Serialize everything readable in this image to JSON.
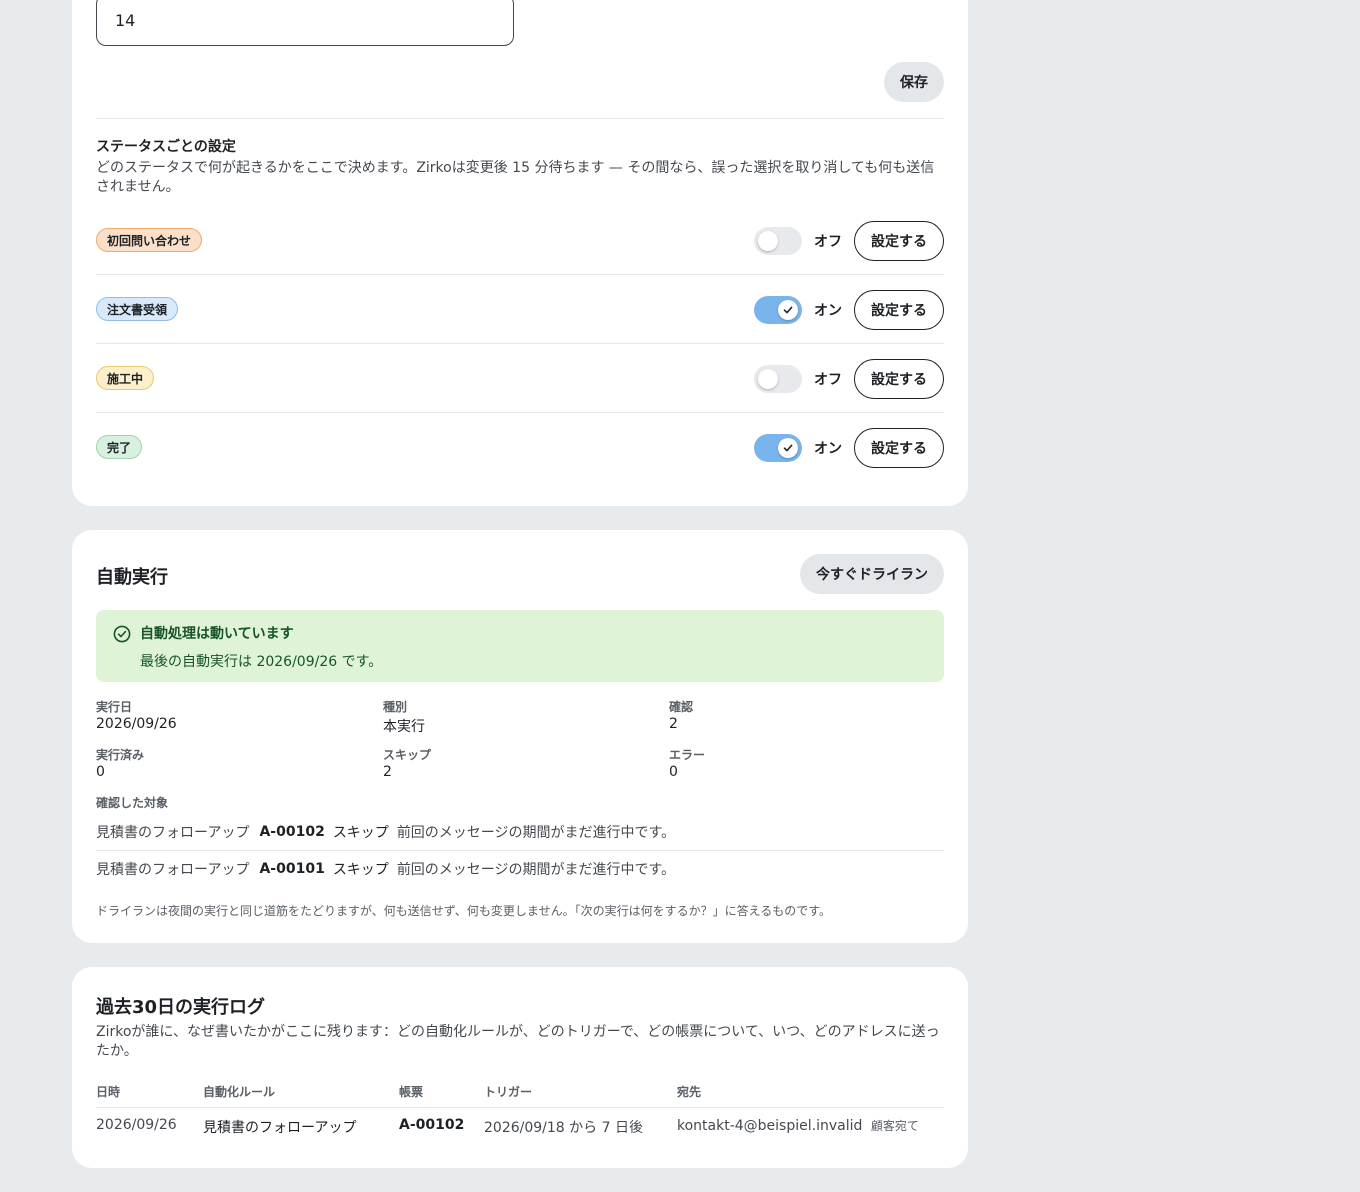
{
  "rules_card": {
    "input_value": "14",
    "save_label": "保存",
    "status_section_title": "ステータスごとの設定",
    "status_section_desc": "どのステータスで何が起きるかをここで決めます。Zirkoは変更後 15 分待ちます — その間なら、誤った選択を取り消しても何も送信されません。",
    "statuses": [
      {
        "label": "初回問い合わせ",
        "state": "オフ",
        "enabled": false,
        "button": "設定する",
        "bg": "#fbe0c9",
        "border": "#f0a969"
      },
      {
        "label": "注文書受領",
        "state": "オン",
        "enabled": true,
        "button": "設定する",
        "bg": "#d7e9fb",
        "border": "#8fbdea"
      },
      {
        "label": "施工中",
        "state": "オフ",
        "enabled": false,
        "button": "設定する",
        "bg": "#fbefcc",
        "border": "#e9c96c"
      },
      {
        "label": "完了",
        "state": "オン",
        "enabled": true,
        "button": "設定する",
        "bg": "#d8f0df",
        "border": "#9fd4ae"
      }
    ]
  },
  "auto_run": {
    "title": "自動実行",
    "dry_run_button": "今すぐドライラン",
    "alert_title": "自動処理は動いています",
    "alert_message": "最後の自動実行は 2026/09/26 です。",
    "fields": [
      {
        "label": "実行日",
        "value": "2026/09/26"
      },
      {
        "label": "種別",
        "value": "本実行"
      },
      {
        "label": "確認",
        "value": "2"
      },
      {
        "label": "実行済み",
        "value": "0"
      },
      {
        "label": "スキップ",
        "value": "2"
      },
      {
        "label": "エラー",
        "value": "0"
      }
    ],
    "targets_label": "確認した対象",
    "targets": [
      {
        "rule": "見積書のフォローアップ",
        "code": "A-00102",
        "result": "スキップ",
        "reason": "前回のメッセージの期間がまだ進行中です。"
      },
      {
        "rule": "見積書のフォローアップ",
        "code": "A-00101",
        "result": "スキップ",
        "reason": "前回のメッセージの期間がまだ進行中です。"
      }
    ],
    "footnote": "ドライランは夜間の実行と同じ道筋をたどりますが、何も送信せず、何も変更しません。「次の実行は何をするか？」に答えるものです。"
  },
  "log": {
    "title": "過去30日の実行ログ",
    "desc": "Zirkoが誰に、なぜ書いたかがここに残ります：どの自動化ルールが、どのトリガーで、どの帳票について、いつ、どのアドレスに送ったか。",
    "headers": [
      "日時",
      "自動化ルール",
      "帳票",
      "トリガー",
      "宛先"
    ],
    "rows": [
      {
        "date": "2026/09/26",
        "rule": "見積書のフォローアップ",
        "doc": "A-00102",
        "trigger": "2026/09/18 から 7 日後",
        "to": "kontakt-4@beispiel.invalid",
        "to_note": "顧客宛て"
      }
    ]
  }
}
